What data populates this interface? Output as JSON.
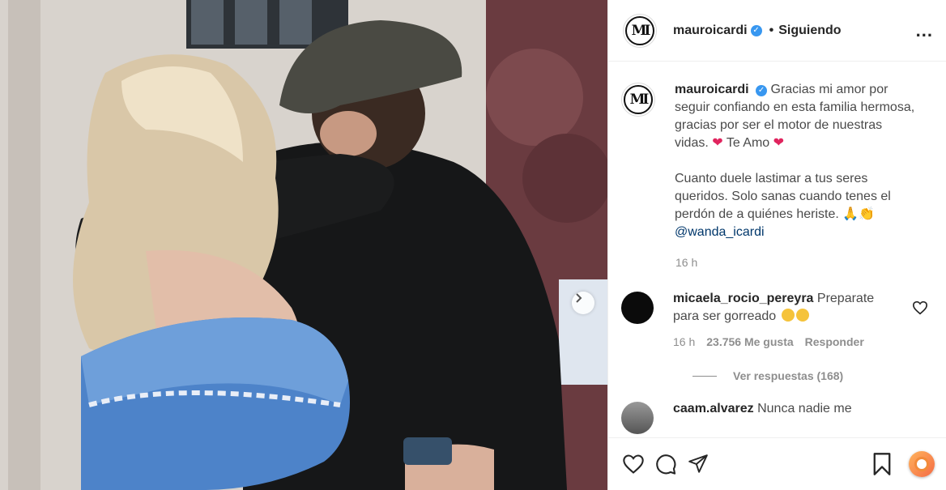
{
  "header": {
    "username": "mauroicardi",
    "verified_mark": "✓",
    "separator": "•",
    "follow_status": "Siguiendo",
    "more": "..."
  },
  "caption": {
    "username": "mauroicardi",
    "line1": "Gracias mi amor por seguir confiando en esta familia hermosa, gracias por ser el motor de nuestras vidas.",
    "te_amo": "Te Amo",
    "line2": "Cuanto duele lastimar a tus seres queridos. Solo sanas cuando tenes el perdón de a quiénes heriste.",
    "mention": "@wanda_icardi",
    "time": "16 h"
  },
  "comments": [
    {
      "username": "micaela_rocio_pereyra",
      "text": "Preparate para ser gorreado",
      "time": "16 h",
      "likes": "23.756 Me gusta",
      "reply": "Responder",
      "view_replies": "Ver respuestas (168)"
    },
    {
      "username": "caam.alvarez",
      "text": "Nunca nadie me"
    }
  ],
  "logo_monogram": "MI",
  "icons": {
    "heart": "heart-icon",
    "comment": "comment-icon",
    "share": "share-icon",
    "save": "bookmark-icon",
    "next": "chevron-right-icon"
  },
  "colors": {
    "verified": "#3897f0",
    "mention": "#00376b",
    "muted": "#8e8e8e"
  }
}
